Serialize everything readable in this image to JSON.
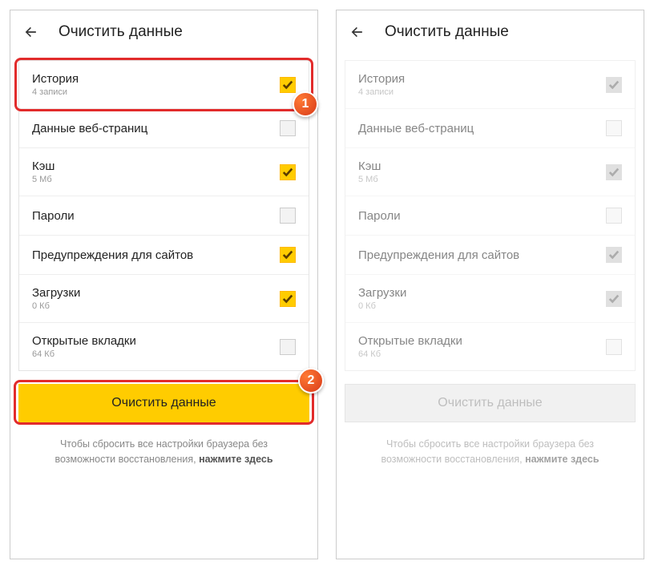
{
  "header": {
    "title": "Очистить данные"
  },
  "rows": [
    {
      "label": "История",
      "sub": "4 записи",
      "checked": true
    },
    {
      "label": "Данные веб-страниц",
      "sub": "",
      "checked": false
    },
    {
      "label": "Кэш",
      "sub": "5 Мб",
      "checked": true
    },
    {
      "label": "Пароли",
      "sub": "",
      "checked": false
    },
    {
      "label": "Предупреждения для сайтов",
      "sub": "",
      "checked": true
    },
    {
      "label": "Загрузки",
      "sub": "0 Кб",
      "checked": true
    },
    {
      "label": "Открытые вкладки",
      "sub": "64 Кб",
      "checked": false
    }
  ],
  "action": {
    "button": "Очистить данные"
  },
  "reset": {
    "line1": "Чтобы сбросить все настройки браузера без",
    "line2_prefix": "возможности восстановления, ",
    "line2_link": "нажмите здесь"
  },
  "badges": {
    "one": "1",
    "two": "2"
  }
}
